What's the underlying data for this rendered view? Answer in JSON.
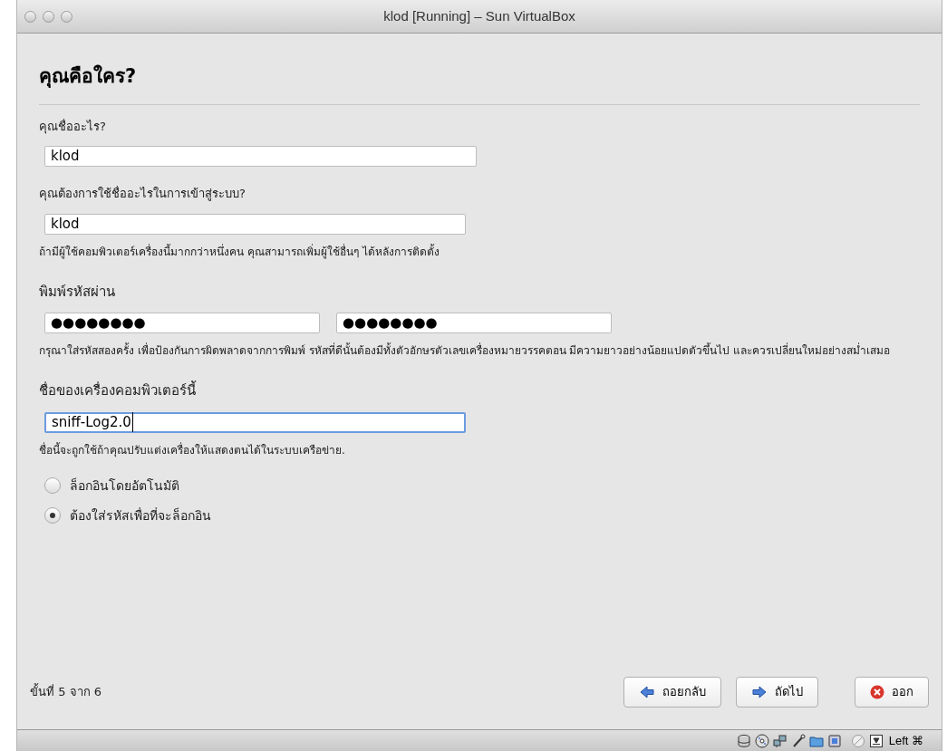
{
  "window": {
    "title": "klod [Running] – Sun VirtualBox"
  },
  "heading": "คุณคือใคร?",
  "sections": [
    {
      "kind": "text",
      "label": "คุณชื่ออะไร?",
      "fields": [
        {
          "value": "klod",
          "focused": false
        }
      ]
    },
    {
      "kind": "text",
      "label": "คุณต้องการใช้ชื่ออะไรในการเข้าสู่ระบบ?",
      "fields": [
        {
          "value": "klod",
          "focused": false
        }
      ],
      "hint": "ถ้ามีผู้ใช้คอมพิวเตอร์เครื่องนี้มากกว่าหนึ่งคน คุณสามารถเพิ่มผู้ใช้อื่นๆ ได้หลังการติดตั้ง"
    },
    {
      "kind": "password",
      "label": "พิมพ์รหัสผ่าน",
      "fields": [
        {
          "value": "●●●●●●●●",
          "focused": false
        },
        {
          "value": "●●●●●●●●",
          "focused": false
        }
      ],
      "hint": "กรุณาใส่รหัสสองครั้ง เพื่อป้องกันการผิดพลาดจากการพิมพ์ รหัสที่ดีนั้นต้องมีทั้งตัวอักษรตัวเลขเครื่องหมายวรรคตอน มีความยาวอย่างน้อยแปดตัวขึ้นไป และควรเปลี่ยนใหม่อย่างสม่ำเสมอ"
    },
    {
      "kind": "text",
      "label": "ชื่อของเครื่องคอมพิวเตอร์นี้",
      "fields": [
        {
          "value": "sniff-Log2.0",
          "focused": true
        }
      ],
      "hint": "ชื่อนี้จะถูกใช้ถ้าคุณปรับแต่งเครื่องให้แสดงตนได้ในระบบเครือข่าย."
    }
  ],
  "login_options": [
    {
      "label": "ล็อกอินโดยอัตโนมัติ",
      "selected": false
    },
    {
      "label": "ต้องใส่รหัสเพื่อที่จะล็อกอิน",
      "selected": true
    }
  ],
  "footer": {
    "step": "ขั้นที่ 5 จาก 6",
    "buttons": [
      {
        "kind": "back",
        "label": "ถอยกลับ"
      },
      {
        "kind": "forward",
        "label": "ถัดไป"
      },
      {
        "kind": "quit",
        "label": "ออก"
      }
    ]
  },
  "status_bar": {
    "host_key": "Left ⌘"
  }
}
